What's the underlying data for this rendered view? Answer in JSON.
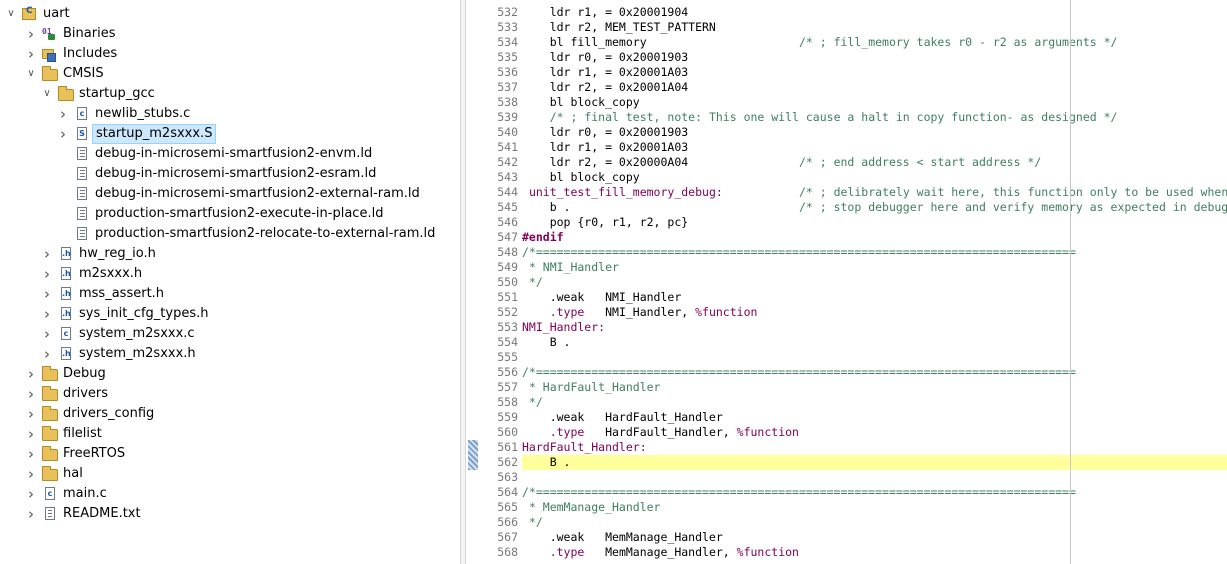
{
  "explorer": {
    "items": [
      {
        "label": "uart",
        "depth": 0,
        "icon": "project-icon",
        "chevron": "expanded"
      },
      {
        "label": "Binaries",
        "depth": 1,
        "icon": "binaries-icon",
        "chevron": "collapsed"
      },
      {
        "label": "Includes",
        "depth": 1,
        "icon": "includes-icon",
        "chevron": "collapsed"
      },
      {
        "label": "CMSIS",
        "depth": 1,
        "icon": "folder-icon",
        "chevron": "expanded"
      },
      {
        "label": "startup_gcc",
        "depth": 2,
        "icon": "folder-icon",
        "chevron": "expanded"
      },
      {
        "label": "newlib_stubs.c",
        "depth": 3,
        "icon": "c-file-icon",
        "chevron": "collapsed"
      },
      {
        "label": "startup_m2sxxx.S",
        "depth": 3,
        "icon": "asm-file-icon",
        "chevron": "collapsed",
        "selected": true
      },
      {
        "label": "debug-in-microsemi-smartfusion2-envm.ld",
        "depth": 3,
        "icon": "linker-file-icon",
        "chevron": "none"
      },
      {
        "label": "debug-in-microsemi-smartfusion2-esram.ld",
        "depth": 3,
        "icon": "linker-file-icon",
        "chevron": "none"
      },
      {
        "label": "debug-in-microsemi-smartfusion2-external-ram.ld",
        "depth": 3,
        "icon": "linker-file-icon",
        "chevron": "none"
      },
      {
        "label": "production-smartfusion2-execute-in-place.ld",
        "depth": 3,
        "icon": "linker-file-icon",
        "chevron": "none"
      },
      {
        "label": "production-smartfusion2-relocate-to-external-ram.ld",
        "depth": 3,
        "icon": "linker-file-icon",
        "chevron": "none"
      },
      {
        "label": "hw_reg_io.h",
        "depth": 2,
        "icon": "h-file-icon",
        "chevron": "collapsed"
      },
      {
        "label": "m2sxxx.h",
        "depth": 2,
        "icon": "h-file-icon",
        "chevron": "collapsed"
      },
      {
        "label": "mss_assert.h",
        "depth": 2,
        "icon": "h-file-icon",
        "chevron": "collapsed"
      },
      {
        "label": "sys_init_cfg_types.h",
        "depth": 2,
        "icon": "h-file-icon",
        "chevron": "collapsed"
      },
      {
        "label": "system_m2sxxx.c",
        "depth": 2,
        "icon": "c-file-icon",
        "chevron": "collapsed"
      },
      {
        "label": "system_m2sxxx.h",
        "depth": 2,
        "icon": "h-file-icon",
        "chevron": "collapsed"
      },
      {
        "label": "Debug",
        "depth": 1,
        "icon": "folder-icon",
        "chevron": "collapsed"
      },
      {
        "label": "drivers",
        "depth": 1,
        "icon": "folder-icon",
        "chevron": "collapsed"
      },
      {
        "label": "drivers_config",
        "depth": 1,
        "icon": "folder-icon",
        "chevron": "collapsed"
      },
      {
        "label": "filelist",
        "depth": 1,
        "icon": "folder-icon",
        "chevron": "collapsed"
      },
      {
        "label": "FreeRTOS",
        "depth": 1,
        "icon": "folder-icon",
        "chevron": "collapsed"
      },
      {
        "label": "hal",
        "depth": 1,
        "icon": "folder-icon",
        "chevron": "collapsed"
      },
      {
        "label": "main.c",
        "depth": 1,
        "icon": "c-file-icon",
        "chevron": "collapsed"
      },
      {
        "label": "README.txt",
        "depth": 1,
        "icon": "text-file-icon",
        "chevron": "collapsed"
      }
    ]
  },
  "editor": {
    "current_line": "562",
    "lines": [
      {
        "n": "532",
        "parts": [
          [
            "    ldr r1, = 0x20001904",
            ""
          ]
        ]
      },
      {
        "n": "533",
        "parts": [
          [
            "    ldr r2, MEM_TEST_PATTERN",
            ""
          ]
        ]
      },
      {
        "n": "534",
        "parts": [
          [
            "    bl fill_memory                      ",
            ""
          ],
          [
            "/* ; fill_memory takes r0 - r2 as arguments */",
            "cm"
          ]
        ]
      },
      {
        "n": "535",
        "parts": [
          [
            "    ldr r0, = 0x20001903",
            ""
          ]
        ]
      },
      {
        "n": "536",
        "parts": [
          [
            "    ldr r1, = 0x20001A03",
            ""
          ]
        ]
      },
      {
        "n": "537",
        "parts": [
          [
            "    ldr r2, = 0x20001A04",
            ""
          ]
        ]
      },
      {
        "n": "538",
        "parts": [
          [
            "    bl block_copy",
            ""
          ]
        ]
      },
      {
        "n": "539",
        "parts": [
          [
            "    ",
            ""
          ],
          [
            "/* ; final test, note: This one will cause a halt in copy function- as designed */",
            "cm"
          ]
        ]
      },
      {
        "n": "540",
        "parts": [
          [
            "    ldr r0, = 0x20001903",
            ""
          ]
        ]
      },
      {
        "n": "541",
        "parts": [
          [
            "    ldr r1, = 0x20001A03",
            ""
          ]
        ]
      },
      {
        "n": "542",
        "parts": [
          [
            "    ldr r2, = 0x20000A04                ",
            ""
          ],
          [
            "/* ; end address < start address */",
            "cm"
          ]
        ]
      },
      {
        "n": "543",
        "parts": [
          [
            "    bl block_copy",
            ""
          ]
        ]
      },
      {
        "n": "544",
        "parts": [
          [
            " ",
            ""
          ],
          [
            "unit_test_fill_memory_debug:",
            "lbl"
          ],
          [
            "           ",
            ""
          ],
          [
            "/* ; delibrately wait here, this function only to be used when debugging */",
            "cm"
          ]
        ]
      },
      {
        "n": "545",
        "parts": [
          [
            "    b .                                 ",
            ""
          ],
          [
            "/* ; stop debugger here and verify memory as expected in debugger */",
            "cm"
          ]
        ]
      },
      {
        "n": "546",
        "parts": [
          [
            "    pop {r0, r1, r2, pc}",
            ""
          ]
        ]
      },
      {
        "n": "547",
        "parts": [
          [
            "#endif",
            "pp"
          ]
        ]
      },
      {
        "n": "548",
        "parts": [
          [
            "/*==============================================================================",
            "cm"
          ]
        ]
      },
      {
        "n": "549",
        "parts": [
          [
            " * NMI_Handler",
            "cm"
          ]
        ]
      },
      {
        "n": "550",
        "parts": [
          [
            " */",
            "cm"
          ]
        ]
      },
      {
        "n": "551",
        "parts": [
          [
            "    .weak   NMI_Handler",
            ""
          ]
        ]
      },
      {
        "n": "552",
        "parts": [
          [
            "    ",
            ""
          ],
          [
            ".type",
            "kw"
          ],
          [
            "   NMI_Handler, ",
            ""
          ],
          [
            "%function",
            "fn"
          ]
        ]
      },
      {
        "n": "553",
        "parts": [
          [
            "NMI_Handler:",
            "lbl"
          ]
        ]
      },
      {
        "n": "554",
        "parts": [
          [
            "    B .",
            ""
          ]
        ]
      },
      {
        "n": "555",
        "parts": [
          [
            "",
            ""
          ]
        ]
      },
      {
        "n": "556",
        "parts": [
          [
            "/*==============================================================================",
            "cm"
          ]
        ]
      },
      {
        "n": "557",
        "parts": [
          [
            " * HardFault_Handler",
            "cm"
          ]
        ]
      },
      {
        "n": "558",
        "parts": [
          [
            " */",
            "cm"
          ]
        ]
      },
      {
        "n": "559",
        "parts": [
          [
            "    .weak   HardFault_Handler",
            ""
          ]
        ]
      },
      {
        "n": "560",
        "parts": [
          [
            "    ",
            ""
          ],
          [
            ".type",
            "kw"
          ],
          [
            "   HardFault_Handler, ",
            ""
          ],
          [
            "%function",
            "fn"
          ]
        ]
      },
      {
        "n": "561",
        "parts": [
          [
            "HardFault_Handler:",
            "lbl"
          ]
        ]
      },
      {
        "n": "562",
        "parts": [
          [
            "    B .",
            ""
          ]
        ]
      },
      {
        "n": "563",
        "parts": [
          [
            "",
            ""
          ]
        ]
      },
      {
        "n": "564",
        "parts": [
          [
            "/*==============================================================================",
            "cm"
          ]
        ]
      },
      {
        "n": "565",
        "parts": [
          [
            " * MemManage_Handler",
            "cm"
          ]
        ]
      },
      {
        "n": "566",
        "parts": [
          [
            " */",
            "cm"
          ]
        ]
      },
      {
        "n": "567",
        "parts": [
          [
            "    .weak   MemManage_Handler",
            ""
          ]
        ]
      },
      {
        "n": "568",
        "parts": [
          [
            "    ",
            ""
          ],
          [
            ".type",
            "kw"
          ],
          [
            "   MemManage_Handler, ",
            ""
          ],
          [
            "%function",
            "fn"
          ]
        ]
      }
    ]
  }
}
